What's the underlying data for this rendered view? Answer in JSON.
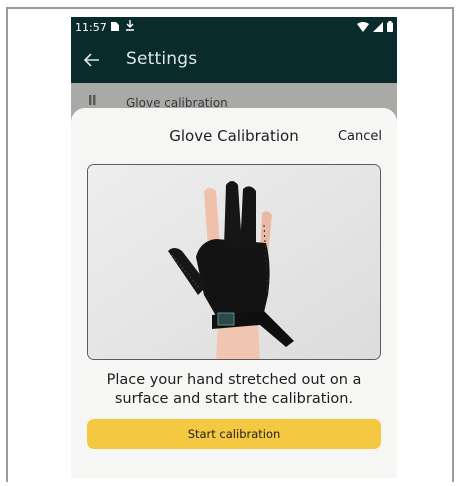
{
  "status_bar": {
    "time": "11:57",
    "left_icons": [
      "sim-card-icon",
      "download-icon"
    ],
    "right_icons": [
      "wifi-icon",
      "signal-icon",
      "battery-icon"
    ]
  },
  "app_bar": {
    "title": "Settings",
    "back_icon": "arrow-left-icon"
  },
  "background_list": {
    "item_label": "Glove calibration"
  },
  "sheet": {
    "title": "Glove Calibration",
    "cancel_label": "Cancel",
    "image_description_icon": "glove-hand-photo",
    "instruction": "Place your hand stretched out on a surface and start the calibration.",
    "start_button_label": "Start calibration"
  },
  "colors": {
    "app_bar_bg": "#0a2b2b",
    "sheet_bg": "#f6f6f5",
    "primary_button": "#f5c842"
  }
}
